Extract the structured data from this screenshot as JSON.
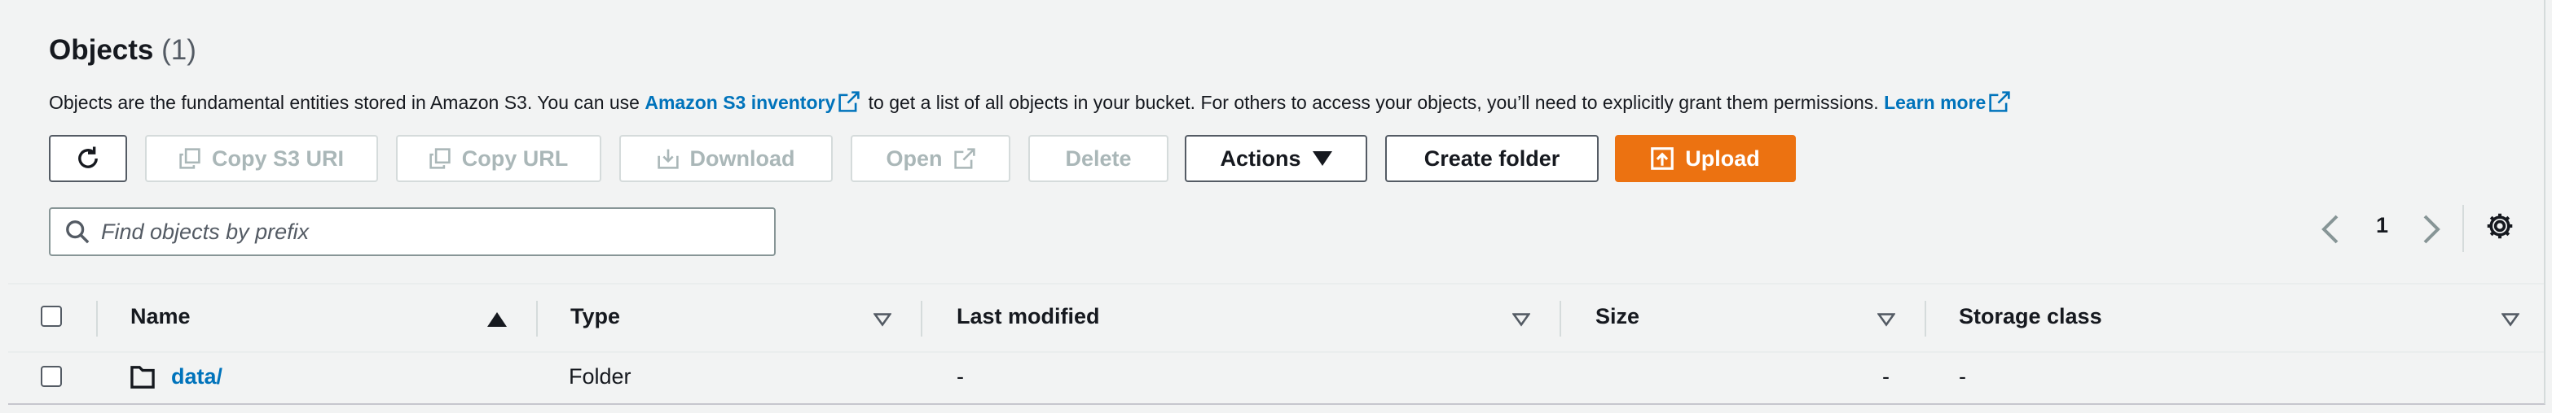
{
  "header": {
    "title": "Objects",
    "count": "(1)"
  },
  "description": {
    "text_before": "Objects are the fundamental entities stored in Amazon S3. You can use",
    "inventory_link": "Amazon S3 inventory",
    "text_middle": "to get a list of all objects in your bucket. For others to access your objects, you’ll need to explicitly grant them permissions.",
    "learn_more": "Learn more"
  },
  "toolbar": {
    "copy_s3_uri": "Copy S3 URI",
    "copy_url": "Copy URL",
    "download": "Download",
    "open": "Open",
    "delete": "Delete",
    "actions": "Actions",
    "create_folder": "Create folder",
    "upload": "Upload"
  },
  "search": {
    "placeholder": "Find objects by prefix"
  },
  "pagination": {
    "current_page": "1"
  },
  "table": {
    "columns": [
      "Name",
      "Type",
      "Last modified",
      "Size",
      "Storage class"
    ],
    "rows": [
      {
        "name": "data/",
        "type": "Folder",
        "last_modified": "-",
        "size": "-",
        "storage_class": "-"
      }
    ]
  },
  "colors": {
    "accent_orange": "#ec7211",
    "link_blue": "#0073bb"
  }
}
